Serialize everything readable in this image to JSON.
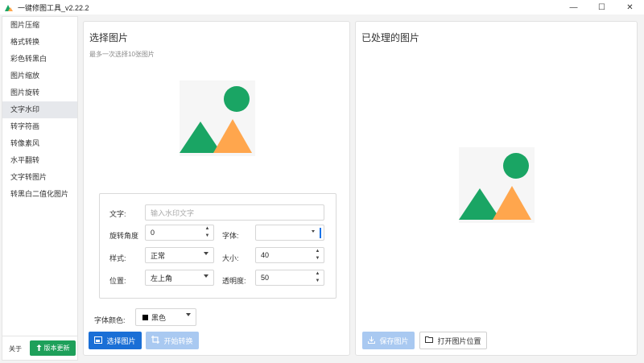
{
  "window": {
    "title": "一键修图工具_v2.22.2",
    "controls": {
      "minimize": "—",
      "maximize": "☐",
      "close": "✕"
    }
  },
  "sidebar": {
    "items": [
      {
        "label": "图片压缩"
      },
      {
        "label": "格式转换"
      },
      {
        "label": "彩色转黑白"
      },
      {
        "label": "图片缩放"
      },
      {
        "label": "图片旋转"
      },
      {
        "label": "文字水印",
        "active": true
      },
      {
        "label": "转字符画"
      },
      {
        "label": "转像素风"
      },
      {
        "label": "水平翻转"
      },
      {
        "label": "文字转图片"
      },
      {
        "label": "转黑白二值化图片"
      }
    ],
    "about": "关于",
    "update_button": "版本更新"
  },
  "left_panel": {
    "title": "选择图片",
    "subtitle": "最多一次选择10张图片",
    "form": {
      "text_label": "文字:",
      "text_placeholder": "输入水印文字",
      "rotation_label": "旋转角度",
      "rotation_value": "0",
      "font_label": "字体:",
      "font_value": "",
      "style_label": "样式:",
      "style_value": "正常",
      "size_label": "大小:",
      "size_value": "40",
      "position_label": "位置:",
      "position_value": "左上角",
      "opacity_label": "透明度:",
      "opacity_value": "50"
    },
    "font_color_label": "字体颜色:",
    "font_color_value": "黑色",
    "font_color_hex": "#000000",
    "select_button": "选择图片",
    "start_button": "开始转换"
  },
  "right_panel": {
    "title": "已处理的图片",
    "save_button": "保存图片",
    "open_location_button": "打开图片位置"
  },
  "colors": {
    "accent": "#1a6fd6",
    "accent_disabled": "#a9c9f1",
    "update_green": "#1ea05a",
    "placeholder_green": "#1aa564",
    "placeholder_orange": "#ffa64d"
  }
}
